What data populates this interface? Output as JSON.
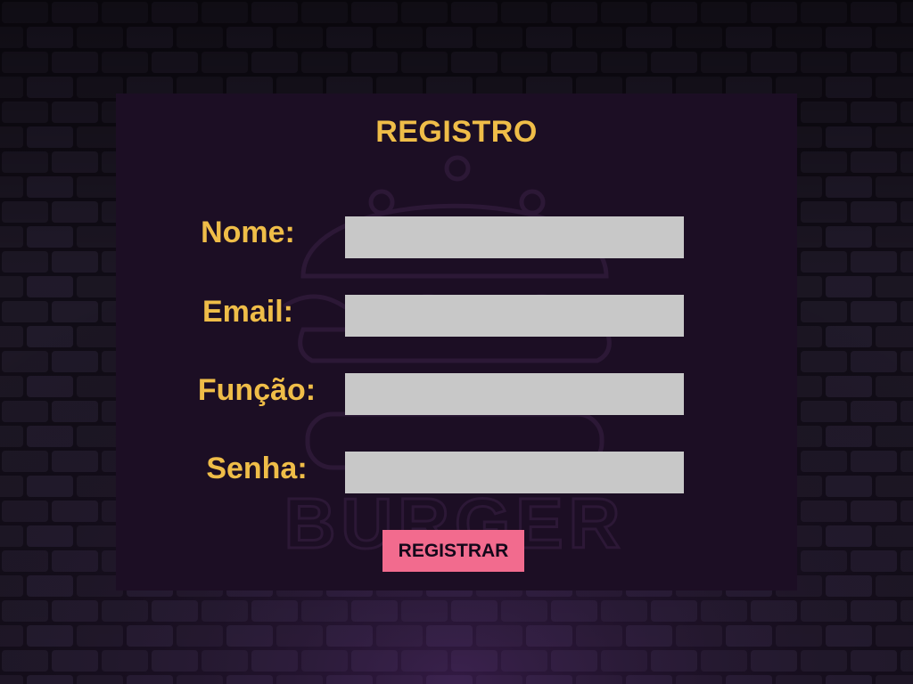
{
  "form": {
    "title": "REGISTRO",
    "fields": [
      {
        "label": "Nome:",
        "value": "",
        "placeholder": ""
      },
      {
        "label": "Email:",
        "value": "",
        "placeholder": ""
      },
      {
        "label": "Função:",
        "value": "",
        "placeholder": ""
      },
      {
        "label": "Senha:",
        "value": "",
        "placeholder": ""
      }
    ],
    "submit_label": "REGISTRAR"
  },
  "background": {
    "watermark_text": "BURGER",
    "watermark_icon": "burger-icon"
  },
  "colors": {
    "accent": "#efbd48",
    "button": "#f26b8e",
    "panel": "#1c0e24",
    "field": "#c8c8c8",
    "wall": "#15101c"
  }
}
